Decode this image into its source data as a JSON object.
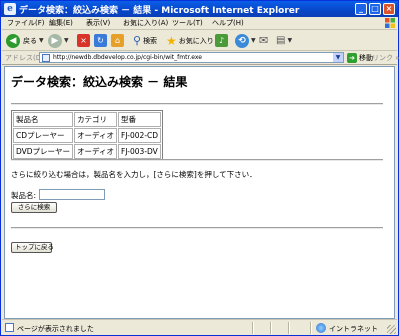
{
  "window": {
    "title": "データ検索：絞込み検索 － 結果 - Microsoft Internet Explorer",
    "app_icon": "ie-icon",
    "buttons": {
      "minimize": "_",
      "maximize": "□",
      "close": "×"
    }
  },
  "menu": [
    "ファイル(F)",
    "編集(E)",
    "表示(V)",
    "お気に入り(A)",
    "ツール(T)",
    "ヘルプ(H)"
  ],
  "toolbar": {
    "back": "戻る",
    "search": "検索",
    "favorites": "お気に入り"
  },
  "address": {
    "label": "アドレス(D)",
    "url": "http://newdb.dbdevelop.co.jp/cgi-bin/wit_fmtr.exe",
    "go": "移動",
    "links": "リンク »"
  },
  "page": {
    "title": "データ検索：絞込み検索 － 結果",
    "table": {
      "headers": [
        "製品名",
        "カテゴリ",
        "型番"
      ],
      "rows": [
        [
          "CDプレーヤー",
          "オーディオ",
          "FJ-002-CD"
        ],
        [
          "DVDプレーヤー",
          "オーディオ",
          "FJ-003-DV"
        ]
      ]
    },
    "instruction": "さらに絞り込む場合は，製品名を入力し，[さらに検索]を押して下さい．",
    "field_label": "製品名:",
    "field_value": "",
    "search_button": "さらに検索",
    "top_button": "トップに戻る"
  },
  "status": {
    "text": "ページが表示されました",
    "zone": "イントラネット"
  }
}
